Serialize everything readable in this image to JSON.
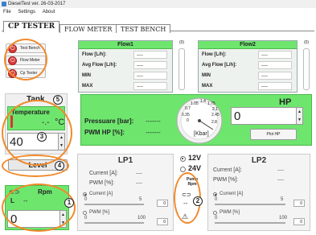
{
  "window": {
    "title": "DieselTest ver. 26-03-2017"
  },
  "menu": {
    "items": [
      "File",
      "Settings",
      "About"
    ]
  },
  "tabs": {
    "cp_tester": "CP TESTER",
    "flow_meter": "FLOW METER",
    "test_bench": "TEST BENCH"
  },
  "sidebar": {
    "test_bench": "Test Bench",
    "flow_meter": "Flow Meter",
    "cp_tester": "Cp Tester"
  },
  "flow1": {
    "title": "Flow1",
    "rows": [
      {
        "label": "Flow [L/h]:",
        "value": "----"
      },
      {
        "label": "Avg Flow [L/h]:",
        "value": "----"
      },
      {
        "label": "MIN",
        "value": "----"
      },
      {
        "label": "MAX",
        "value": "----"
      }
    ],
    "scroll_value": "(0)"
  },
  "flow2": {
    "title": "Flow2",
    "rows": [
      {
        "label": "Flow [L/h]:",
        "value": "----"
      },
      {
        "label": "Avg Flow [L/h]:",
        "value": "----"
      },
      {
        "label": "MIN",
        "value": "----"
      },
      {
        "label": "MAX",
        "value": "----"
      }
    ],
    "scroll_value": "(0)"
  },
  "tank": {
    "title": "Tank",
    "temperature_label": "Temperature",
    "temperature_value": "-.-",
    "temperature_unit": "°C",
    "setpoint": "40",
    "level_label": "Level"
  },
  "rpm": {
    "label": "Rpm",
    "l_label": "L",
    "value": "--",
    "setpoint": "0"
  },
  "pressure": {
    "pressure_label": "Pressuare [bar]:",
    "pressure_value": "-------",
    "pwm_label": "PWM HP [%]:",
    "pwm_value": "-------",
    "gauge_unit": "[Kbar]",
    "gauge_ticks": [
      "0",
      "0.35",
      "0.7",
      "1.05",
      "1.4",
      "1.75",
      "2.1",
      "2.45",
      "2.8"
    ]
  },
  "hp": {
    "title": "HP",
    "value": "0",
    "plot_button": "Plot HP"
  },
  "voltage": {
    "v12": "12V",
    "v24": "24V",
    "selected": "12V"
  },
  "pump": {
    "label": "Pump Rpm",
    "value": "--"
  },
  "lp1": {
    "title": "LP1",
    "current_label": "Current [A]:",
    "current_value": "----",
    "pwm_label": "PWM [%]:",
    "pwm_value": "----",
    "mode_current": "Current [A]",
    "mode_pwm": "PWM [%]",
    "current_slider_min": "0",
    "current_slider_max": "5",
    "current_setpoint": "0",
    "pwm_slider_min": "0",
    "pwm_slider_max": "100",
    "pwm_setpoint": "0"
  },
  "lp2": {
    "title": "LP2",
    "current_label": "Current [A]:",
    "current_value": "----",
    "pwm_label": "PWM [%]:",
    "pwm_value": "----",
    "mode_current": "Current [A]",
    "mode_pwm": "PWM [%]",
    "current_slider_min": "0",
    "current_slider_max": "5",
    "current_setpoint": "0",
    "pwm_slider_min": "0",
    "pwm_slider_max": "100",
    "pwm_setpoint": "0"
  },
  "annotations": {
    "n1": "1",
    "n2": "2",
    "n3": "3",
    "n4": "4",
    "n5": "5"
  },
  "colors": {
    "panel_green": "#6ee66e",
    "annotation_orange": "#f08a2c",
    "power_red": "#d63a3a"
  }
}
